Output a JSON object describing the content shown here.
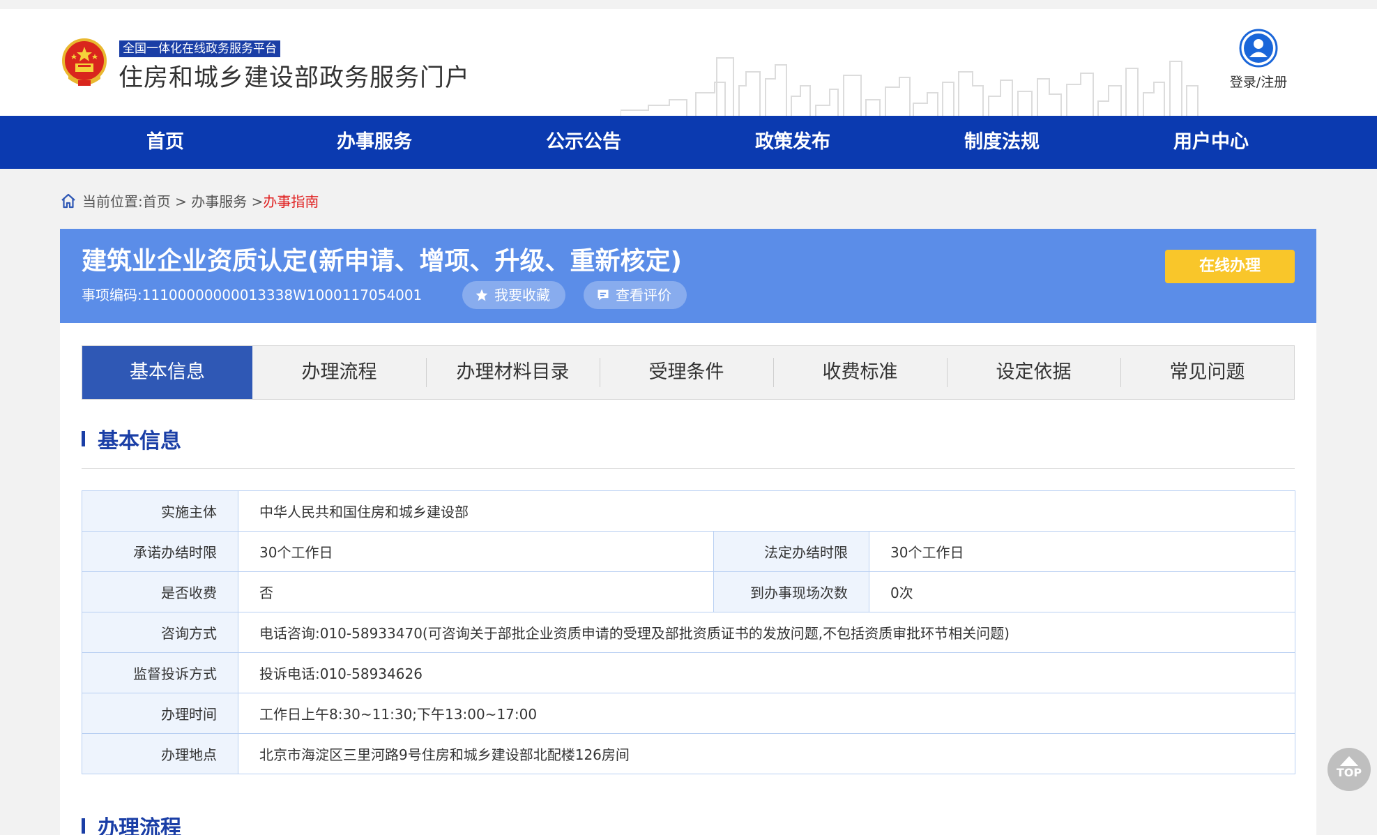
{
  "header": {
    "platform_tag": "全国一体化在线政务服务平台",
    "portal_title": "住房和城乡建设部政务服务门户",
    "login_label": "登录/注册"
  },
  "nav": {
    "items": [
      "首页",
      "办事服务",
      "公示公告",
      "政策发布",
      "制度法规",
      "用户中心"
    ]
  },
  "breadcrumb": {
    "prefix": "当前位置:",
    "home": "首页",
    "sep1": " > ",
    "service": "办事服务",
    "sep2": " >",
    "current": "办事指南"
  },
  "item": {
    "title": "建筑业企业资质认定(新申请、增项、升级、重新核定)",
    "code_label": "事项编码:",
    "code": "11100000000013338W1000117054001",
    "favorite_label": "我要收藏",
    "review_label": "查看评价",
    "online_label": "在线办理"
  },
  "tabs": {
    "items": [
      "基本信息",
      "办理流程",
      "办理材料目录",
      "受理条件",
      "收费标准",
      "设定依据",
      "常见问题"
    ],
    "active_index": 0
  },
  "basic_info": {
    "section_title": "基本信息",
    "subject_label": "实施主体",
    "subject_value": "中华人民共和国住房和城乡建设部",
    "promised_label": "承诺办结时限",
    "promised_value": "30个工作日",
    "legal_label": "法定办结时限",
    "legal_value": "30个工作日",
    "fee_label": "是否收费",
    "fee_value": "否",
    "visits_label": "到办事现场次数",
    "visits_value": "0次",
    "consult_label": "咨询方式",
    "consult_value": "电话咨询:010-58933470(可咨询关于部批企业资质申请的受理及部批资质证书的发放问题,不包括资质审批环节相关问题)",
    "complaint_label": "监督投诉方式",
    "complaint_value": "投诉电话:010-58934626",
    "hours_label": "办理时间",
    "hours_value": "工作日上午8:30~11:30;下午13:00~17:00",
    "address_label": "办理地点",
    "address_value": "北京市海淀区三里河路9号住房和城乡建设部北配楼126房间"
  },
  "process": {
    "section_title": "办理流程"
  },
  "back_to_top": "TOP",
  "colors": {
    "nav_blue": "#0b3ab0",
    "banner_blue": "#5b8de8",
    "active_tab": "#2f58b5",
    "online_button": "#f9c62a",
    "breadcrumb_current": "#e02020",
    "section_title": "#1a3ea6"
  },
  "icons": [
    "national-emblem-icon",
    "user-avatar-icon",
    "home-icon",
    "star-icon",
    "comment-icon",
    "arrow-up-icon"
  ]
}
